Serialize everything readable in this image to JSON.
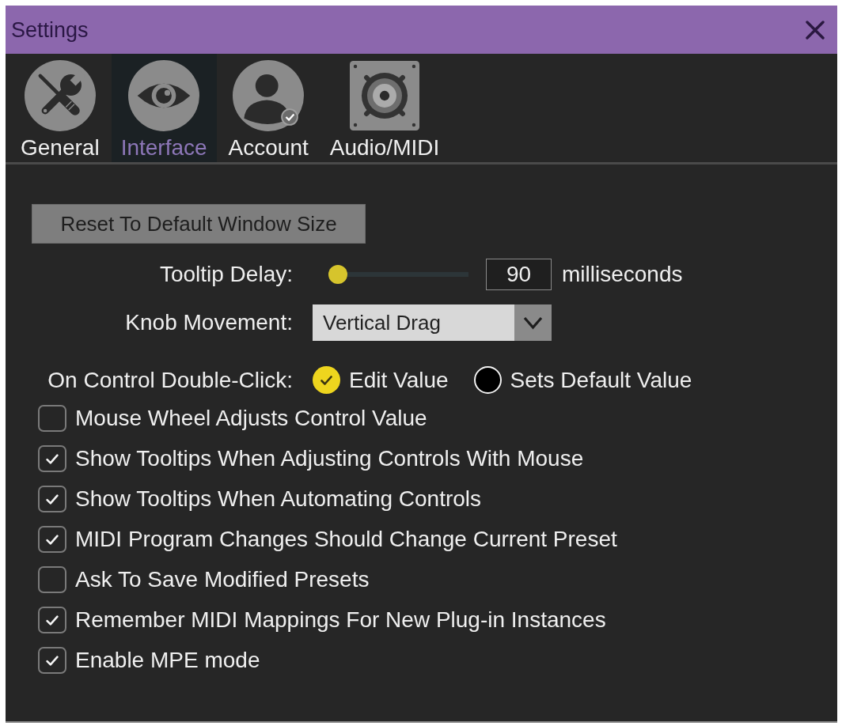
{
  "window": {
    "title": "Settings"
  },
  "tabs": [
    {
      "label": "General",
      "kind": "general",
      "selected": false
    },
    {
      "label": "Interface",
      "kind": "interface",
      "selected": true
    },
    {
      "label": "Account",
      "kind": "account",
      "selected": false
    },
    {
      "label": "Audio/MIDI",
      "kind": "audio",
      "selected": false
    }
  ],
  "reset_button": {
    "label": "Reset To Default Window Size"
  },
  "tooltip_delay": {
    "label": "Tooltip Delay:",
    "level": 0,
    "value": "90",
    "unit": "milliseconds"
  },
  "knob_movement": {
    "label": "Knob Movement:",
    "value": "Vertical Drag"
  },
  "double_click": {
    "label": "On Control Double-Click:",
    "options": [
      {
        "label": "Edit Value",
        "selected": true
      },
      {
        "label": "Sets Default Value",
        "selected": false
      }
    ]
  },
  "checkboxes": [
    {
      "label": "Mouse Wheel Adjusts Control Value",
      "checked": false
    },
    {
      "label": "Show Tooltips When Adjusting Controls With Mouse",
      "checked": true
    },
    {
      "label": "Show Tooltips When Automating Controls",
      "checked": true
    },
    {
      "label": "MIDI Program Changes Should Change Current Preset",
      "checked": true
    },
    {
      "label": "Ask To Save Modified Presets",
      "checked": false
    },
    {
      "label": "Remember MIDI Mappings For New Plug-in Instances",
      "checked": true
    },
    {
      "label": "Enable MPE mode",
      "checked": true
    }
  ]
}
